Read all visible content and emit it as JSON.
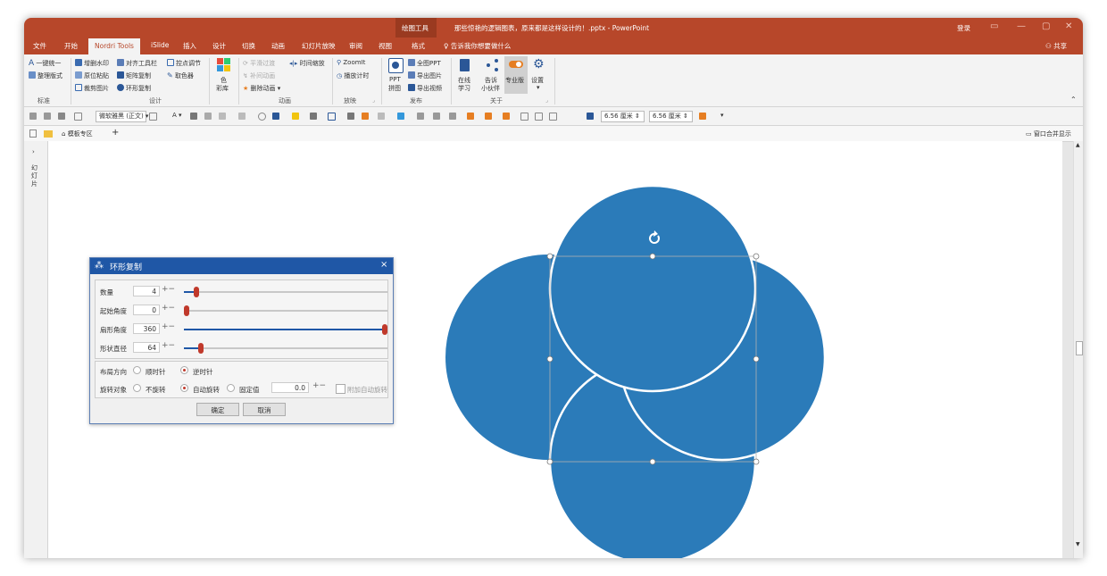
{
  "title_bar": {
    "context_tab": "绘图工具",
    "document_title": "那些惊艳的逻辑图表，原来都是这样设计的！.pptx - PowerPoint",
    "login": "登录",
    "share": "共享"
  },
  "tabs": [
    {
      "label": "文件"
    },
    {
      "label": "开始"
    },
    {
      "label": "Nordri Tools",
      "active": true
    },
    {
      "label": "iSlide"
    },
    {
      "label": "插入"
    },
    {
      "label": "设计"
    },
    {
      "label": "切换"
    },
    {
      "label": "动画"
    },
    {
      "label": "幻灯片放映"
    },
    {
      "label": "审阅"
    },
    {
      "label": "视图"
    },
    {
      "label": "格式"
    }
  ],
  "tell_me": "告诉我你想要做什么",
  "ribbon": {
    "standard": {
      "items": [
        "一键统一",
        "整理版式"
      ],
      "group": "标准"
    },
    "design": {
      "col1": [
        "增删水印",
        "原位粘贴",
        "裁剪图片"
      ],
      "col2": [
        "对齐工具栏",
        "矩阵复制",
        "环形复制"
      ],
      "col3": [
        "控点调节",
        "取色器"
      ],
      "group": "设计"
    },
    "color_lib": {
      "line1": "色",
      "line2": "彩库"
    },
    "animation": {
      "items": [
        "平滑过渡",
        "补间动画",
        "删除动画"
      ],
      "time_zoom": "时间缩放",
      "group": "动画"
    },
    "playback": {
      "items": [
        "ZoomIt",
        "播放计时"
      ],
      "group": "放映"
    },
    "publish": {
      "ppt_line1": "PPT",
      "ppt_line2": "拼图",
      "items": [
        "全图PPT",
        "导出图片",
        "导出视频"
      ],
      "group": "发布"
    },
    "about": {
      "online_l1": "在线",
      "online_l2": "学习",
      "tell_l1": "告诉",
      "tell_l2": "小伙伴",
      "pro": "专业版",
      "settings": "设置",
      "group": "关于"
    }
  },
  "format_toolbar": {
    "font": "微软雅黑 (正文)",
    "width": "6.56 厘米",
    "height": "6.56 厘米"
  },
  "doc_tabs": {
    "template_zone": "模板专区",
    "merge_windows": "窗口合并显示"
  },
  "sidebar": {
    "label": "幻灯片"
  },
  "dialog": {
    "title": "环形复制",
    "rows": [
      {
        "label": "数量",
        "value": "4",
        "fraction": 0.05
      },
      {
        "label": "起始角度",
        "value": "0",
        "fraction": 0.0
      },
      {
        "label": "扇形角度",
        "value": "360",
        "fraction": 1.0
      },
      {
        "label": "形状直径",
        "value": "64",
        "fraction": 0.07
      }
    ],
    "layout_direction": {
      "label": "布局方向",
      "clockwise": "顺时针",
      "counter_clockwise": "逆时针",
      "selected": "逆时针"
    },
    "rotation": {
      "label": "旋转对象",
      "none": "不旋转",
      "auto": "自动旋转",
      "fixed": "固定值",
      "selected": "自动旋转",
      "fixed_value": "0.0",
      "extra": "附加自动旋转"
    },
    "ok": "确定",
    "cancel": "取消"
  },
  "colors": {
    "accent": "#b7472a",
    "dialog_title": "#1f57a6",
    "circle_fill": "#2b7bb9",
    "slider_thumb": "#c0392b"
  }
}
